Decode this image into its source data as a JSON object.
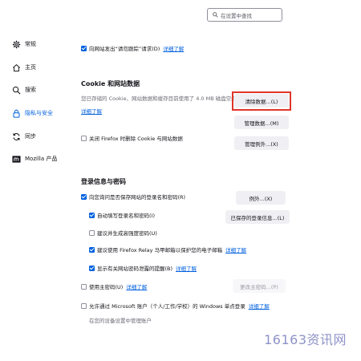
{
  "search": {
    "placeholder": "在设置中查找"
  },
  "sidebar": {
    "items": [
      {
        "label": "常规",
        "icon": "gear-icon"
      },
      {
        "label": "主页",
        "icon": "home-icon"
      },
      {
        "label": "搜索",
        "icon": "search-icon"
      },
      {
        "label": "隐私与安全",
        "icon": "lock-icon",
        "selected": true
      },
      {
        "label": "同步",
        "icon": "sync-icon"
      },
      {
        "label": "Mozilla 产品",
        "icon": "mozilla-icon"
      }
    ]
  },
  "dnt": {
    "label": "向网站发出“请勿跟踪”请求(D)",
    "link": "详细了解",
    "checked": true
  },
  "cookies": {
    "title": "Cookie 和网站数据",
    "description": "您已存储的 Cookie、网站数据和缓存目前使用了 4.0 MB 磁盘空间。",
    "link": "详细了解",
    "clear_button": "清除数据...(L)",
    "manage_button": "管理数据...(M)",
    "exceptions_button": "管理例外...(X)",
    "delete_on_close": {
      "label": "关闭 Firefox 时删除 Cookie 与网站数据",
      "checked": false
    }
  },
  "logins": {
    "title": "登录信息与密码",
    "ask_save": {
      "label": "向您询问是否保存网站的登录名和密码(R)",
      "checked": true
    },
    "exceptions_button": "例外...(X)",
    "autofill": {
      "label": "自动填写登录名和密码(I)",
      "checked": true
    },
    "saved_logins_button": "已保存的登录信息...(L)",
    "suggest_strong": {
      "label": "建议并生成高强度密码(U)",
      "checked": false
    },
    "relay": {
      "label": "建议使用 Firefox Relay 马甲邮箱以保护您的电子邮箱",
      "link": "详细了解",
      "checked": true
    },
    "breach_alerts": {
      "label": "显示有关网站密码泄露的提醒(B)",
      "link": "详细了解",
      "checked": true
    },
    "primary_password": {
      "label": "使用主密码(U)",
      "link": "详细了解",
      "checked": false
    },
    "change_primary_button": "更改主密码...(P)",
    "windows_sso": {
      "label": "允许通过 Microsoft 账户（个人/工作/学校）的 Windows 单点登录",
      "link": "详细了解",
      "checked": false
    },
    "windows_sso_note": "在您的设备设置中管理账户"
  },
  "watermark": "16163资讯网",
  "colors": {
    "accent": "#0060df",
    "highlight": "#e0352b",
    "button_bg": "#f0f0f4"
  }
}
